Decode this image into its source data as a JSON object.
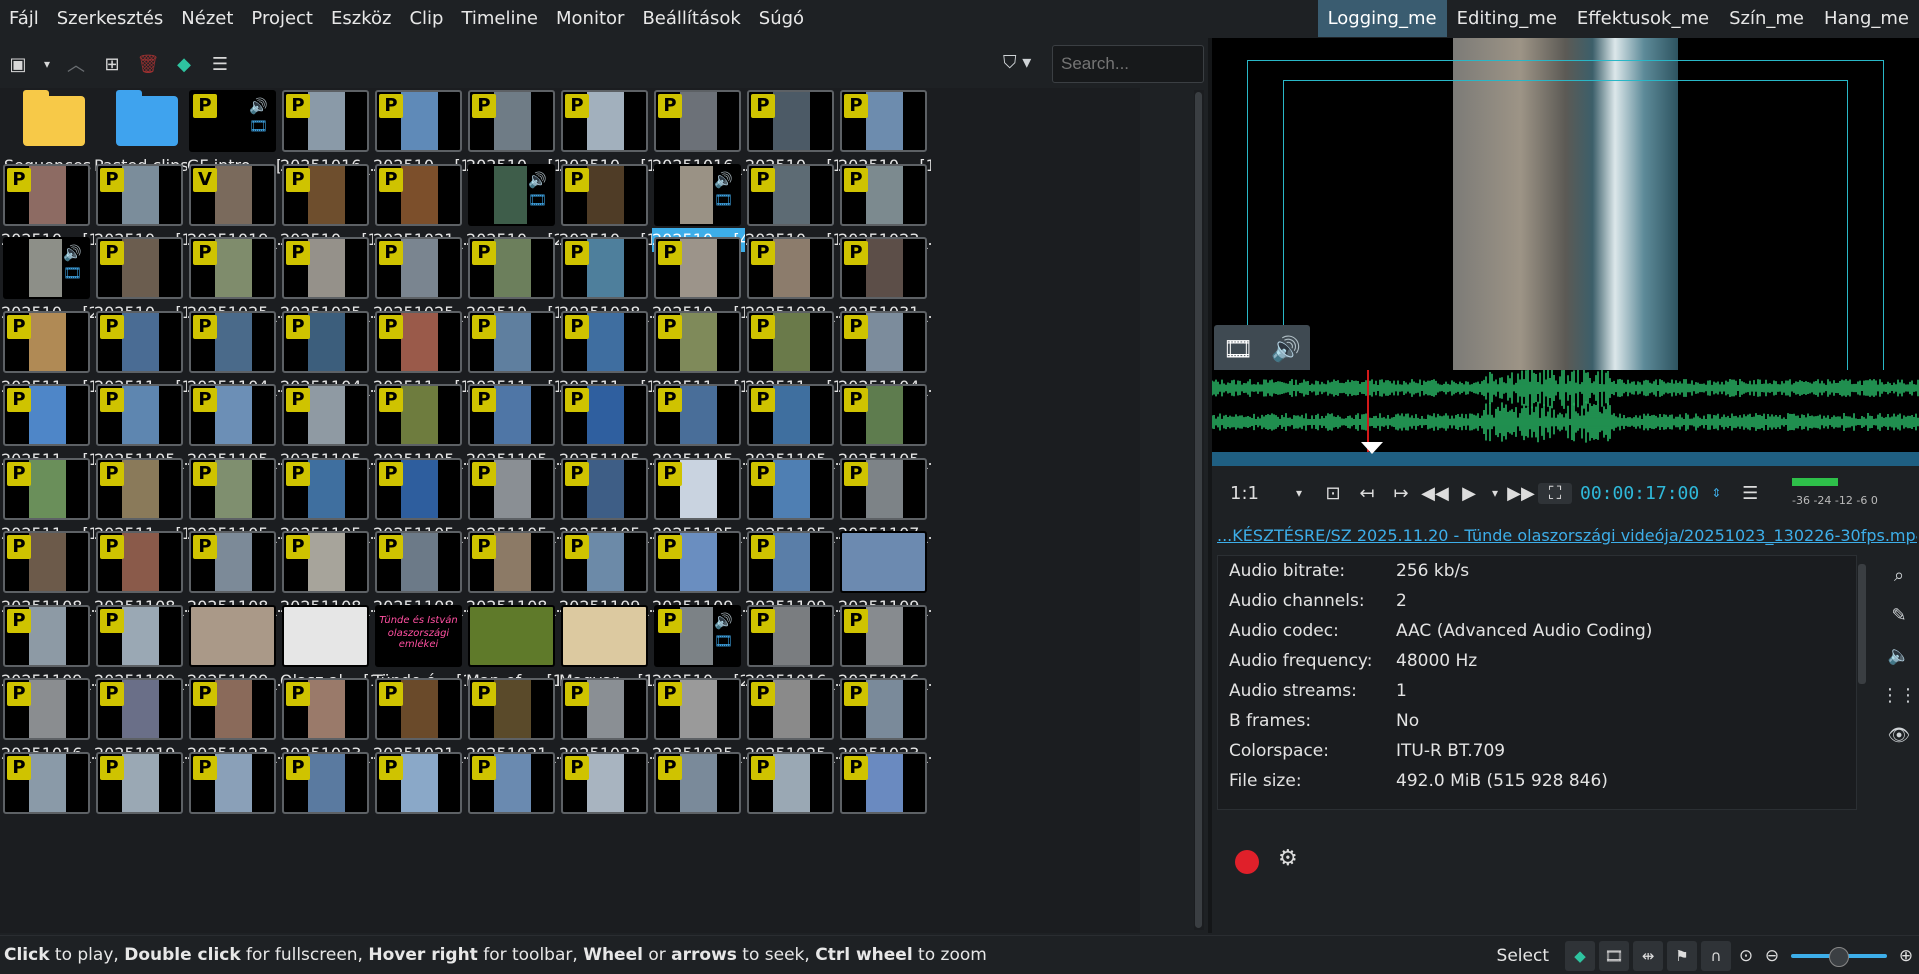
{
  "menu": [
    "Fájl",
    "Szerkesztés",
    "Nézet",
    "Project",
    "Eszköz",
    "Clip",
    "Timeline",
    "Monitor",
    "Beállítások",
    "Súgó"
  ],
  "workspaces": [
    "Logging_me",
    "Editing_me",
    "Effektusok_me",
    "Szín_me",
    "Hang_me"
  ],
  "active_workspace": "Logging_me",
  "bin": {
    "search_placeholder": "Search...",
    "items": [
      {
        "label": "Sequences",
        "kind": "folder",
        "color": "#f7c948"
      },
      {
        "label": "Pasted clips",
        "kind": "folder",
        "color": "#3fa3ee"
      },
      {
        "label": "GF intro ... [2]",
        "kind": "av",
        "badge": "P",
        "color": "#000000"
      },
      {
        "label": "20251016_...",
        "badge": "P",
        "color": "#8a9aa8"
      },
      {
        "label": "202510... [1]",
        "badge": "P",
        "color": "#5f8ab8"
      },
      {
        "label": "202510... [1]",
        "badge": "P",
        "color": "#6f7c86"
      },
      {
        "label": "202510... [1]",
        "badge": "P",
        "color": "#a2b0bd"
      },
      {
        "label": "20251016_...",
        "badge": "P",
        "color": "#6c7178"
      },
      {
        "label": "202510... [1]",
        "badge": "P",
        "color": "#4c5a66"
      },
      {
        "label": "202510... [1]",
        "badge": "P",
        "color": "#6d8cae"
      },
      {
        "label": "202510... [1]",
        "badge": "P",
        "color": "#8d6b63"
      },
      {
        "label": "202510... [1]",
        "badge": "P",
        "color": "#7b8d9b"
      },
      {
        "label": "20251019_...",
        "badge": "V",
        "color": "#7a6a5c"
      },
      {
        "label": "202510... [1]",
        "badge": "P",
        "color": "#6e4e2d"
      },
      {
        "label": "20251021_...",
        "badge": "P",
        "color": "#7c4f2b"
      },
      {
        "label": "202510... [2]",
        "kind": "av",
        "color": "#3e5d4a"
      },
      {
        "label": "202510... [1]",
        "badge": "P",
        "color": "#4f3c26"
      },
      {
        "label": "202510... [4]",
        "kind": "av",
        "color": "#9a9285",
        "selected": true
      },
      {
        "label": "202510... [1]",
        "badge": "P",
        "color": "#5d6b74"
      },
      {
        "label": "20251023_...",
        "badge": "P",
        "color": "#7c8a8f"
      },
      {
        "label": "202510... [2]",
        "kind": "av",
        "color": "#8d8f88"
      },
      {
        "label": "202510... [1]",
        "badge": "P",
        "color": "#6b5d4f"
      },
      {
        "label": "20251025_...",
        "badge": "P",
        "color": "#7f8c6c"
      },
      {
        "label": "20251025_...",
        "badge": "P",
        "color": "#95918a"
      },
      {
        "label": "20251025_...",
        "badge": "P",
        "color": "#7a8590"
      },
      {
        "label": "202510... [1]",
        "badge": "P",
        "color": "#6c7f5c"
      },
      {
        "label": "20251028_...",
        "badge": "P",
        "color": "#4e7f9c"
      },
      {
        "label": "202510... [1]",
        "badge": "P",
        "color": "#9c948a"
      },
      {
        "label": "20251028_...",
        "badge": "P",
        "color": "#8c7c6c"
      },
      {
        "label": "20251031_...",
        "badge": "P",
        "color": "#5c4e48"
      },
      {
        "label": "202511... [1]",
        "badge": "P",
        "color": "#b08a55"
      },
      {
        "label": "202511... [1]",
        "badge": "P",
        "color": "#4a6c94"
      },
      {
        "label": "20251104_...",
        "badge": "P",
        "color": "#4a6a8a"
      },
      {
        "label": "20251104_...",
        "badge": "P",
        "color": "#3c5e7c"
      },
      {
        "label": "202511... [1]",
        "badge": "P",
        "color": "#9a5a4a"
      },
      {
        "label": "202511... [1]",
        "badge": "P",
        "color": "#5f7f9f"
      },
      {
        "label": "202511... [1]",
        "badge": "P",
        "color": "#3f6ea0"
      },
      {
        "label": "202511... [1]",
        "badge": "P",
        "color": "#7f8a5a"
      },
      {
        "label": "202511... [1]",
        "badge": "P",
        "color": "#6a7a4a"
      },
      {
        "label": "20251104_...",
        "badge": "P",
        "color": "#7c8c9c"
      },
      {
        "label": "202511... [1]",
        "badge": "P",
        "color": "#4e86c8"
      },
      {
        "label": "20251105_...",
        "badge": "P",
        "color": "#5e86b0"
      },
      {
        "label": "20251105_...",
        "badge": "P",
        "color": "#6c8fb6"
      },
      {
        "label": "20251105_...",
        "badge": "P",
        "color": "#8f9aa3"
      },
      {
        "label": "20251105_...",
        "badge": "P",
        "color": "#6e7c3e"
      },
      {
        "label": "20251105_...",
        "badge": "P",
        "color": "#4f76a6"
      },
      {
        "label": "20251105_...",
        "badge": "P",
        "color": "#2f5f9f"
      },
      {
        "label": "20251105_...",
        "badge": "P",
        "color": "#496e99"
      },
      {
        "label": "20251105_...",
        "badge": "P",
        "color": "#3f6f9f"
      },
      {
        "label": "20251105_...",
        "badge": "P",
        "color": "#5e7c4e"
      },
      {
        "label": "202511... [1]",
        "badge": "P",
        "color": "#6a8f5a"
      },
      {
        "label": "202511... [1]",
        "badge": "P",
        "color": "#8a7a5a"
      },
      {
        "label": "20251105_...",
        "badge": "P",
        "color": "#7f8f6f"
      },
      {
        "label": "20251105_...",
        "badge": "P",
        "color": "#3f6f9f"
      },
      {
        "label": "20251105_...",
        "badge": "P",
        "color": "#2e5e9e"
      },
      {
        "label": "20251105_...",
        "badge": "P",
        "color": "#8a8f94"
      },
      {
        "label": "20251105_...",
        "badge": "P",
        "color": "#3e5e86"
      },
      {
        "label": "20251105_...",
        "badge": "P",
        "color": "#c9d3e0"
      },
      {
        "label": "20251105_...",
        "badge": "P",
        "color": "#4f7fb3"
      },
      {
        "label": "20251107_...",
        "badge": "P",
        "color": "#7d8387"
      },
      {
        "label": "20251108_...",
        "badge": "P",
        "color": "#6c5a4a"
      },
      {
        "label": "20251108_...",
        "badge": "P",
        "color": "#8a5a4a"
      },
      {
        "label": "20251108_...",
        "badge": "P",
        "color": "#7c8a98"
      },
      {
        "label": "20251108_...",
        "badge": "P",
        "color": "#a7a49b"
      },
      {
        "label": "20251108_...",
        "badge": "P",
        "color": "#6c7a88"
      },
      {
        "label": "20251108_...",
        "badge": "P",
        "color": "#8c7a66"
      },
      {
        "label": "20251109_...",
        "badge": "P",
        "color": "#6c8aa8"
      },
      {
        "label": "20251109_...",
        "badge": "P",
        "color": "#6a8ec0"
      },
      {
        "label": "20251109_...",
        "badge": "P",
        "color": "#5a7ea8"
      },
      {
        "label": "20251109_...",
        "kind": "plain",
        "color": "#6c8ab0"
      },
      {
        "label": "20251109_...",
        "badge": "P",
        "color": "#8d9aa5"
      },
      {
        "label": "20251109_...",
        "badge": "P",
        "color": "#9aa8b4"
      },
      {
        "label": "20251109_...",
        "kind": "plain",
        "color": "#aa9988"
      },
      {
        "label": "Olasz al... [1]",
        "kind": "plain",
        "color": "#e6e6e6"
      },
      {
        "label": "Tünde é... [1]",
        "kind": "title",
        "color": "#000000",
        "title_lines": [
          "Tünde és István",
          "olaszországi emlékei"
        ]
      },
      {
        "label": "Map-of-... [1]",
        "kind": "plain",
        "color": "#5f7a2a"
      },
      {
        "label": "Magyar... [1]",
        "kind": "plain",
        "color": "#dcc9a0"
      },
      {
        "label": "202510... [2]",
        "kind": "av",
        "badge": "P",
        "color": "#7c8286"
      },
      {
        "label": "20251016_...",
        "badge": "P",
        "color": "#7a7d80"
      },
      {
        "label": "20251016_...",
        "badge": "P",
        "color": "#878b8f"
      },
      {
        "label": "20251016_...",
        "badge": "P",
        "color": "#8a8d90"
      },
      {
        "label": "20251019_...",
        "badge": "P",
        "color": "#6a6f88"
      },
      {
        "label": "20251023_...",
        "badge": "P",
        "color": "#8a6a5a"
      },
      {
        "label": "20251023_...",
        "badge": "P",
        "color": "#9a7a6a"
      },
      {
        "label": "20251021_...",
        "badge": "P",
        "color": "#6a4a2a"
      },
      {
        "label": "20251021_...",
        "badge": "P",
        "color": "#5a4a2a"
      },
      {
        "label": "20251023_...",
        "badge": "P",
        "color": "#8a8f94"
      },
      {
        "label": "20251025_...",
        "badge": "P",
        "color": "#9a9a9a"
      },
      {
        "label": "20251025_...",
        "badge": "P",
        "color": "#8a8a8a"
      },
      {
        "label": "20251023_...",
        "badge": "P",
        "color": "#7a8a9a"
      },
      {
        "label": "",
        "badge": "P",
        "color": "#8a9aa8"
      },
      {
        "label": "",
        "badge": "P",
        "color": "#9aa8b4"
      },
      {
        "label": "",
        "badge": "P",
        "color": "#8aa0b8"
      },
      {
        "label": "",
        "badge": "P",
        "color": "#5a7aa0"
      },
      {
        "label": "",
        "badge": "P",
        "color": "#8aa8c8"
      },
      {
        "label": "",
        "badge": "P",
        "color": "#6a8ab0"
      },
      {
        "label": "",
        "badge": "P",
        "color": "#a8b4c0"
      },
      {
        "label": "",
        "badge": "P",
        "color": "#7a8a9a"
      },
      {
        "label": "",
        "badge": "P",
        "color": "#9aa8b4"
      },
      {
        "label": "",
        "badge": "P",
        "color": "#6a8ac0"
      }
    ]
  },
  "monitor": {
    "zoom": "1:1",
    "timecode": "00:00:17:00",
    "meter_scale": "-36 -24     -12 -6  0",
    "playhead_position": 0.22
  },
  "clip_path": "...KÉSZTÉSRE/SZ 2025.11.20 - Tünde olaszországi videója/20251023_130226-30fps.mp4",
  "properties": [
    {
      "key": "Audio bitrate:",
      "value": "256 kb/s"
    },
    {
      "key": "Audio channels:",
      "value": "2"
    },
    {
      "key": "Audio codec:",
      "value": "AAC (Advanced Audio Coding)"
    },
    {
      "key": "Audio frequency:",
      "value": "48000 Hz"
    },
    {
      "key": "Audio streams:",
      "value": "1"
    },
    {
      "key": "B frames:",
      "value": "No"
    },
    {
      "key": "Colorspace:",
      "value": "ITU-R BT.709"
    },
    {
      "key": "File size:",
      "value": "492.0 MiB (515 928 846)"
    }
  ],
  "status": {
    "hint_parts": [
      {
        "t": "Click",
        "b": true
      },
      {
        "t": " to play, ",
        "b": false
      },
      {
        "t": "Double click",
        "b": true
      },
      {
        "t": " for fullscreen, ",
        "b": false
      },
      {
        "t": "Hover right",
        "b": true
      },
      {
        "t": " for toolbar, ",
        "b": false
      },
      {
        "t": "Wheel",
        "b": true
      },
      {
        "t": " or ",
        "b": false
      },
      {
        "t": "arrows",
        "b": true
      },
      {
        "t": " to seek, ",
        "b": false
      },
      {
        "t": "Ctrl wheel",
        "b": true
      },
      {
        "t": " to zoom",
        "b": false
      }
    ],
    "tool": "Select"
  },
  "colors": {
    "accent": "#3daee9",
    "timecode": "#2fb8d9",
    "record": "#e0202a",
    "waveform": "#2ecc71",
    "guide": "#29b7c7"
  }
}
